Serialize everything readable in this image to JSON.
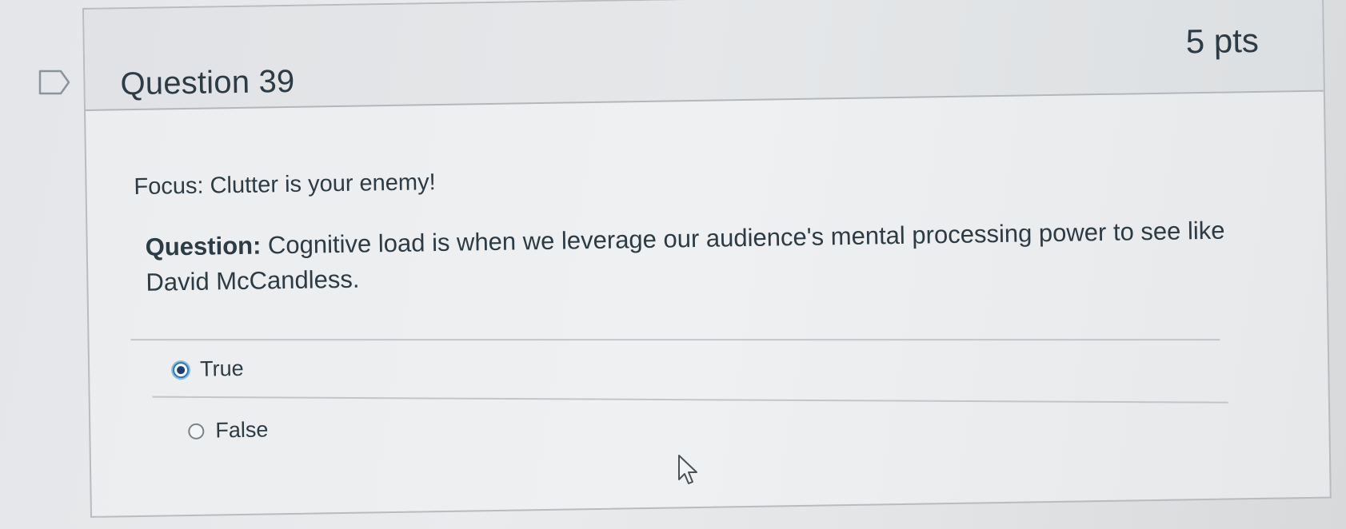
{
  "question": {
    "title": "Question 39",
    "points": "5 pts",
    "focus": "Focus: Clutter is your enemy!",
    "prompt_label": "Question:",
    "prompt_text": " Cognitive load is when we leverage our audience's mental processing power to see like David McCandless."
  },
  "answers": [
    {
      "label": "True",
      "selected": true
    },
    {
      "label": "False",
      "selected": false
    }
  ],
  "icons": {
    "flag": "flag-question-icon",
    "radio_selected": "radio-checked-icon",
    "radio_unselected": "radio-unchecked-icon",
    "cursor": "mouse-pointer-icon"
  },
  "colors": {
    "radio_selected": "#2b7abc",
    "text": "#2d3b45"
  }
}
